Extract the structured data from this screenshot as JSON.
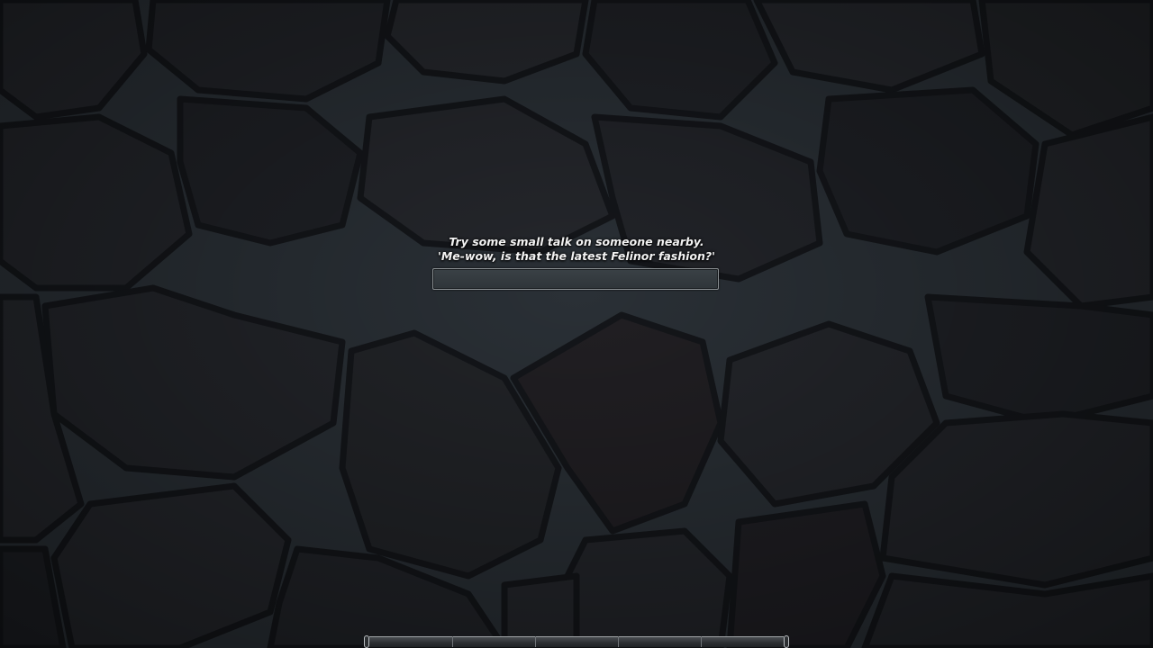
{
  "loading_tip": {
    "line1": "Try some small talk on someone nearby.",
    "line2": "'Me-wow, is that the latest Felinor fashion?'"
  },
  "loading_progress": 0,
  "xp_bar": {
    "segments": 5,
    "progress": 0
  },
  "colors": {
    "background": "#1c1e22",
    "stone": "#23252a",
    "mortar": "#15171a",
    "tip_text": "#f2f2f2",
    "bar_border": "#8a8f92"
  }
}
